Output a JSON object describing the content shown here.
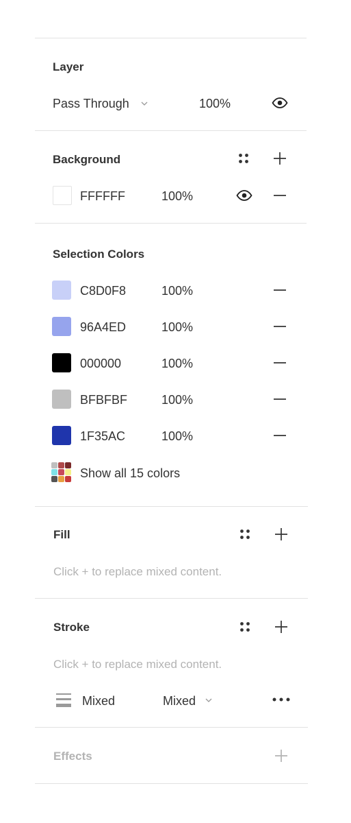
{
  "layer": {
    "title": "Layer",
    "blend_mode": "Pass Through",
    "opacity": "100%",
    "visible": true
  },
  "background": {
    "title": "Background",
    "hex": "FFFFFF",
    "opacity": "100%",
    "swatch": "#FFFFFF"
  },
  "selection_colors": {
    "title": "Selection Colors",
    "items": [
      {
        "hex": "C8D0F8",
        "opacity": "100%",
        "swatch": "#C8D0F8"
      },
      {
        "hex": "96A4ED",
        "opacity": "100%",
        "swatch": "#96A4ED"
      },
      {
        "hex": "000000",
        "opacity": "100%",
        "swatch": "#000000"
      },
      {
        "hex": "BFBFBF",
        "opacity": "100%",
        "swatch": "#BFBFBF"
      },
      {
        "hex": "1F35AC",
        "opacity": "100%",
        "swatch": "#1F35AC"
      }
    ],
    "show_all_label": "Show all 15 colors",
    "preview_colors": [
      "#BFBFBF",
      "#B04A4A",
      "#7A2A2A",
      "#7FE3E8",
      "#C84A5A",
      "#F5F08A",
      "#555555",
      "#E8A040",
      "#C83A3A"
    ]
  },
  "fill": {
    "title": "Fill",
    "hint": "Click + to replace mixed content."
  },
  "stroke": {
    "title": "Stroke",
    "hint": "Click + to replace mixed content.",
    "weight": "Mixed",
    "position": "Mixed"
  },
  "effects": {
    "title": "Effects"
  }
}
